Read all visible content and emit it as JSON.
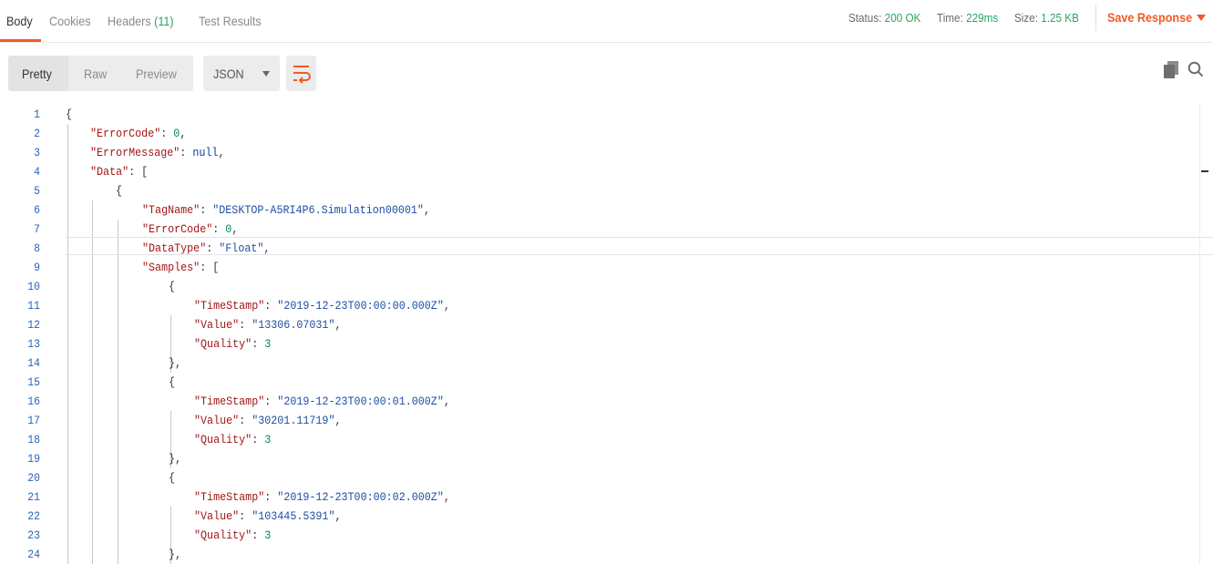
{
  "tabs": [
    {
      "label": "Body"
    },
    {
      "label": "Cookies"
    },
    {
      "label": "Headers",
      "count": "(11)"
    },
    {
      "label": "Test Results"
    }
  ],
  "status": {
    "status_label": "Status:",
    "status_value": "200 OK",
    "time_label": "Time:",
    "time_value": "229ms",
    "size_label": "Size:",
    "size_value": "1.25 KB"
  },
  "save_response": "Save Response",
  "toolbar": {
    "formats": [
      "Pretty",
      "Raw",
      "Preview"
    ],
    "language": "JSON",
    "wrap_icon": "wrap-lines-icon",
    "copy_icon": "copy-icon",
    "search_icon": "search-icon"
  },
  "colors": {
    "accent": "#ef5b25",
    "status_ok": "#26a65b",
    "line_number": "#2a63b8",
    "json_key": "#a31515",
    "json_string": "#1f4fa3",
    "json_number": "#098658"
  },
  "code": {
    "line_numbers": [
      "1",
      "2",
      "3",
      "4",
      "5",
      "6",
      "7",
      "8",
      "9",
      "10",
      "11",
      "12",
      "13",
      "14",
      "15",
      "16",
      "17",
      "18",
      "19",
      "20",
      "21",
      "22",
      "23",
      "24"
    ],
    "lines": [
      [
        {
          "t": "p",
          "v": "{"
        }
      ],
      [
        {
          "t": "k",
          "v": "\"ErrorCode\""
        },
        {
          "t": "p",
          "v": ": "
        },
        {
          "t": "n",
          "v": "0"
        },
        {
          "t": "p",
          "v": ","
        }
      ],
      [
        {
          "t": "k",
          "v": "\"ErrorMessage\""
        },
        {
          "t": "p",
          "v": ": "
        },
        {
          "t": "nl",
          "v": "null"
        },
        {
          "t": "p",
          "v": ","
        }
      ],
      [
        {
          "t": "k",
          "v": "\"Data\""
        },
        {
          "t": "p",
          "v": ": ["
        }
      ],
      [
        {
          "t": "p",
          "v": "{"
        }
      ],
      [
        {
          "t": "k",
          "v": "\"TagName\""
        },
        {
          "t": "p",
          "v": ": "
        },
        {
          "t": "s",
          "v": "\"DESKTOP-A5RI4P6.Simulation00001\""
        },
        {
          "t": "p",
          "v": ","
        }
      ],
      [
        {
          "t": "k",
          "v": "\"ErrorCode\""
        },
        {
          "t": "p",
          "v": ": "
        },
        {
          "t": "n",
          "v": "0"
        },
        {
          "t": "p",
          "v": ","
        }
      ],
      [
        {
          "t": "k",
          "v": "\"DataType\""
        },
        {
          "t": "p",
          "v": ": "
        },
        {
          "t": "s",
          "v": "\"Float\""
        },
        {
          "t": "p",
          "v": ","
        }
      ],
      [
        {
          "t": "k",
          "v": "\"Samples\""
        },
        {
          "t": "p",
          "v": ": ["
        }
      ],
      [
        {
          "t": "p",
          "v": "{"
        }
      ],
      [
        {
          "t": "k",
          "v": "\"TimeStamp\""
        },
        {
          "t": "p",
          "v": ": "
        },
        {
          "t": "s",
          "v": "\"2019-12-23T00:00:00.000Z\""
        },
        {
          "t": "p",
          "v": ","
        }
      ],
      [
        {
          "t": "k",
          "v": "\"Value\""
        },
        {
          "t": "p",
          "v": ": "
        },
        {
          "t": "s",
          "v": "\"13306.07031\""
        },
        {
          "t": "p",
          "v": ","
        }
      ],
      [
        {
          "t": "k",
          "v": "\"Quality\""
        },
        {
          "t": "p",
          "v": ": "
        },
        {
          "t": "n",
          "v": "3"
        }
      ],
      [
        {
          "t": "p",
          "v": "},"
        }
      ],
      [
        {
          "t": "p",
          "v": "{"
        }
      ],
      [
        {
          "t": "k",
          "v": "\"TimeStamp\""
        },
        {
          "t": "p",
          "v": ": "
        },
        {
          "t": "s",
          "v": "\"2019-12-23T00:00:01.000Z\""
        },
        {
          "t": "p",
          "v": ","
        }
      ],
      [
        {
          "t": "k",
          "v": "\"Value\""
        },
        {
          "t": "p",
          "v": ": "
        },
        {
          "t": "s",
          "v": "\"30201.11719\""
        },
        {
          "t": "p",
          "v": ","
        }
      ],
      [
        {
          "t": "k",
          "v": "\"Quality\""
        },
        {
          "t": "p",
          "v": ": "
        },
        {
          "t": "n",
          "v": "3"
        }
      ],
      [
        {
          "t": "p",
          "v": "},"
        }
      ],
      [
        {
          "t": "p",
          "v": "{"
        }
      ],
      [
        {
          "t": "k",
          "v": "\"TimeStamp\""
        },
        {
          "t": "p",
          "v": ": "
        },
        {
          "t": "s",
          "v": "\"2019-12-23T00:00:02.000Z\""
        },
        {
          "t": "p",
          "v": ","
        }
      ],
      [
        {
          "t": "k",
          "v": "\"Value\""
        },
        {
          "t": "p",
          "v": ": "
        },
        {
          "t": "s",
          "v": "\"103445.5391\""
        },
        {
          "t": "p",
          "v": ","
        }
      ],
      [
        {
          "t": "k",
          "v": "\"Quality\""
        },
        {
          "t": "p",
          "v": ": "
        },
        {
          "t": "n",
          "v": "3"
        }
      ],
      [
        {
          "t": "p",
          "v": "},"
        }
      ]
    ]
  }
}
